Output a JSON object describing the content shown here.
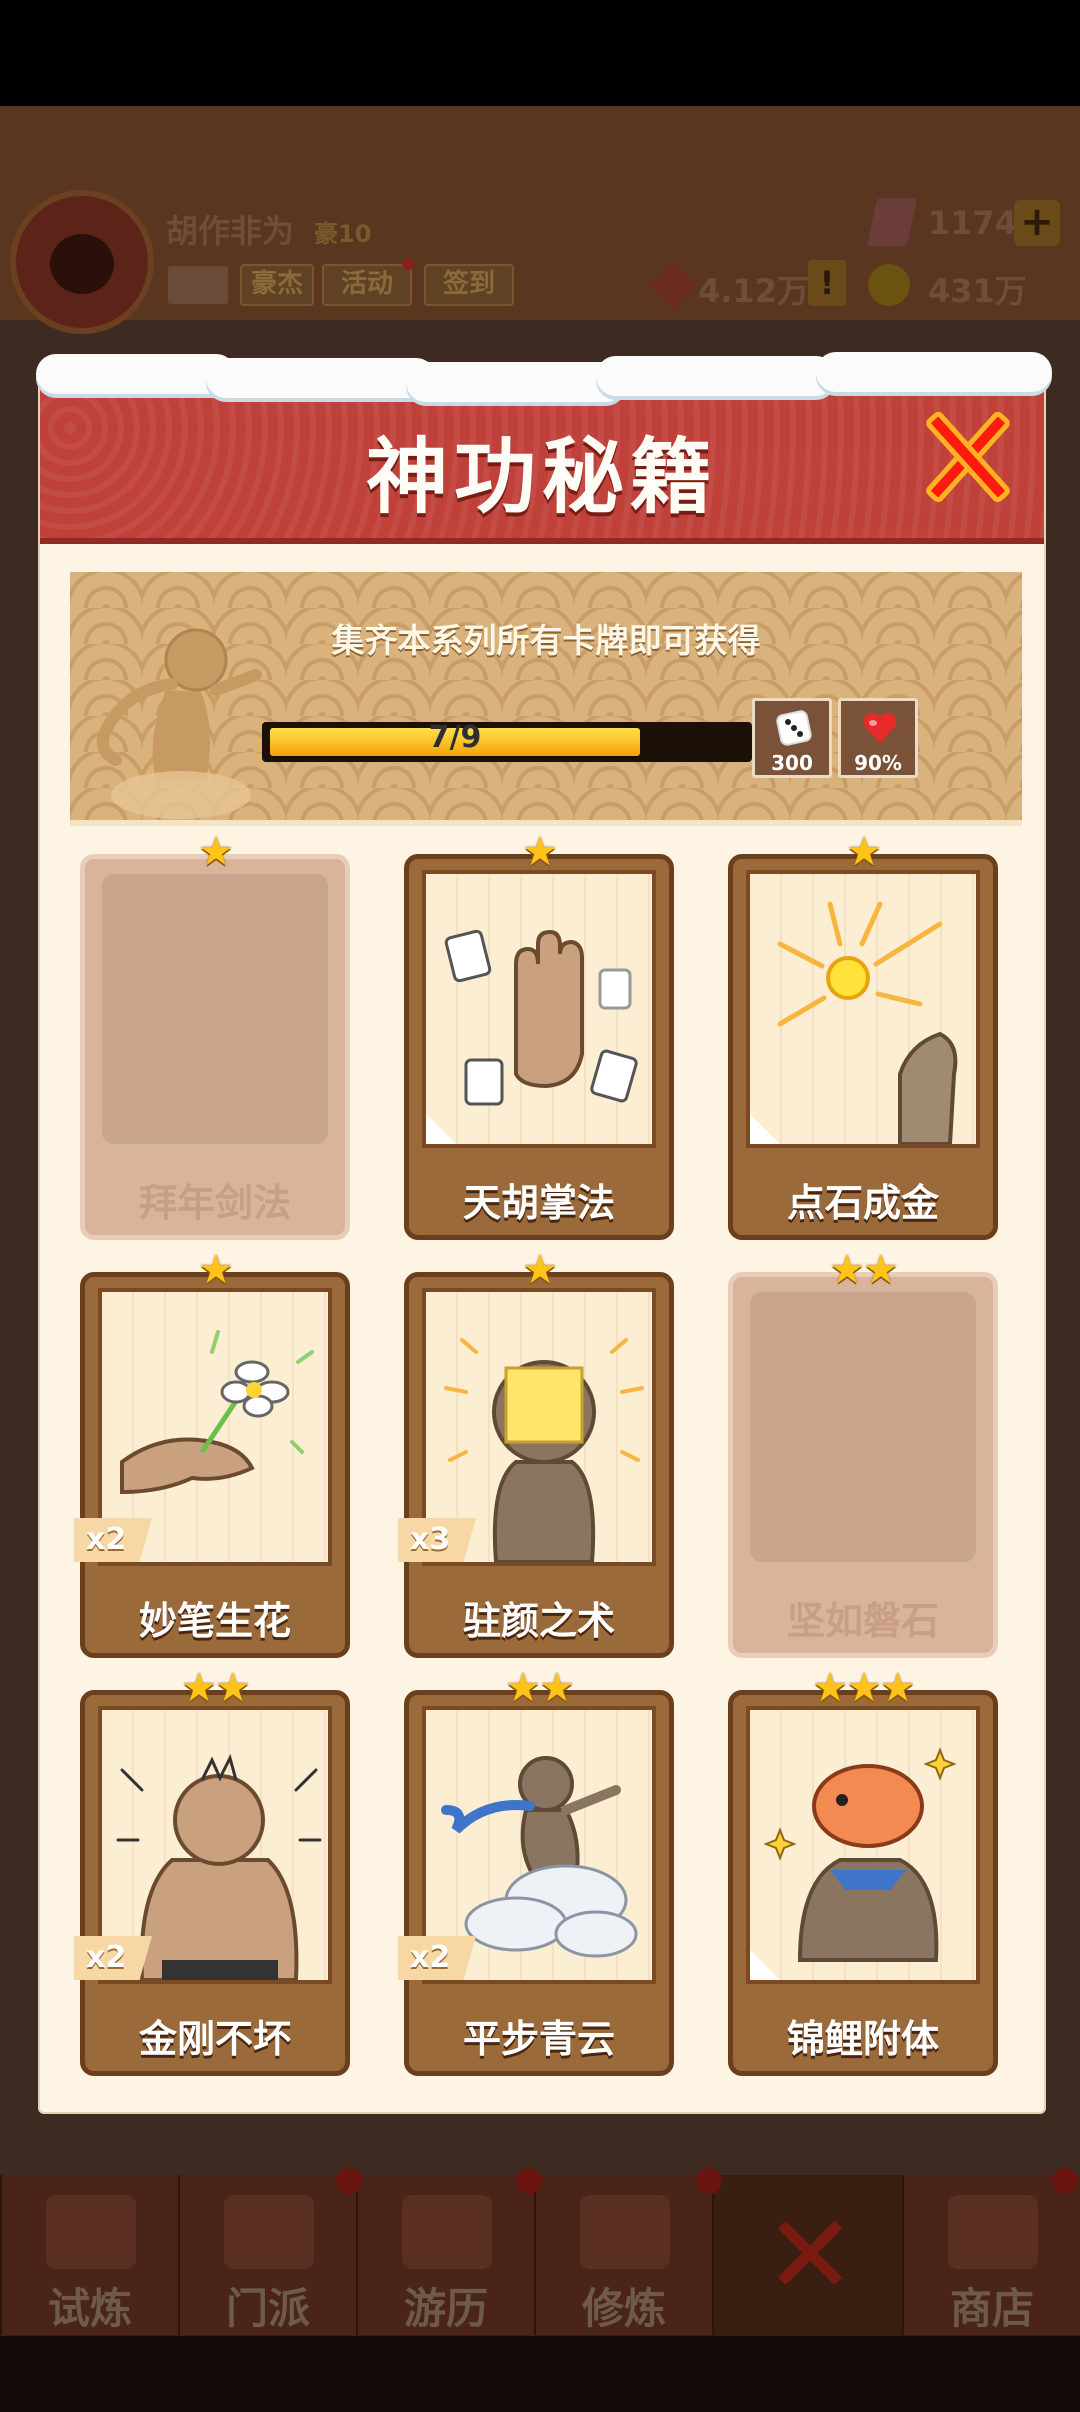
{
  "header": {
    "player_name": "胡作非为",
    "rank": "豪10",
    "hero_label": "豪杰",
    "event_label": "活动",
    "checkin_label": "签到",
    "gems": "1174",
    "plus_label": "+",
    "power": "4.12万",
    "alert_label": "!",
    "coins": "431万"
  },
  "modal": {
    "title": "神功秘籍",
    "banner_text": "集齐本系列所有卡牌即可获得",
    "progress": {
      "collected": 7,
      "total": 9,
      "text": "7/9"
    },
    "rewards": [
      {
        "icon": "dice-icon",
        "value": "300"
      },
      {
        "icon": "heart-icon",
        "value": "90%"
      }
    ],
    "cards": [
      {
        "name": "拜年剑法",
        "stars": "★",
        "locked": true,
        "count": ""
      },
      {
        "name": "天胡掌法",
        "stars": "★",
        "locked": false,
        "count": ""
      },
      {
        "name": "点石成金",
        "stars": "★",
        "locked": false,
        "count": ""
      },
      {
        "name": "妙笔生花",
        "stars": "★",
        "locked": false,
        "count": "x2"
      },
      {
        "name": "驻颜之术",
        "stars": "★",
        "locked": false,
        "count": "x3"
      },
      {
        "name": "坚如磐石",
        "stars": "★★",
        "locked": true,
        "count": ""
      },
      {
        "name": "金刚不坏",
        "stars": "★★",
        "locked": false,
        "count": "x2"
      },
      {
        "name": "平步青云",
        "stars": "★★",
        "locked": false,
        "count": "x2"
      },
      {
        "name": "锦鲤附体",
        "stars": "★★★",
        "locked": false,
        "count": ""
      }
    ]
  },
  "nav": {
    "tabs": [
      "试炼",
      "门派",
      "游历",
      "修炼",
      "",
      "商店"
    ]
  },
  "colors": {
    "title_red": "#c0413a",
    "modal_bg": "#fdf4e3",
    "card_brown": "#9b6a3a",
    "star_gold": "#ffc31a",
    "progress_fill": "#f4a20a"
  }
}
